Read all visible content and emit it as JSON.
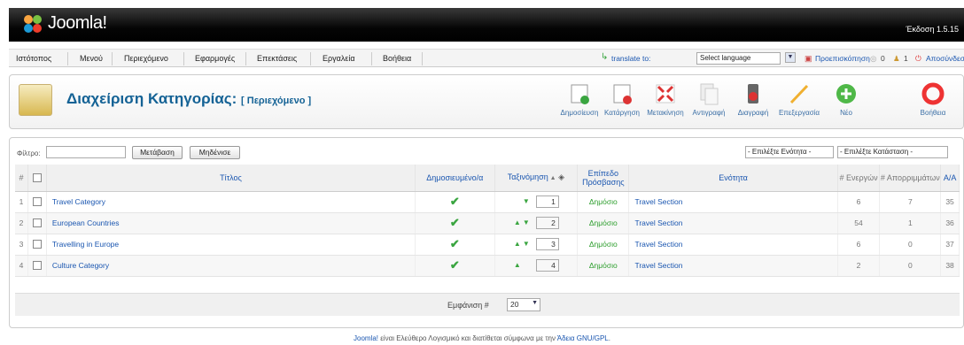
{
  "header": {
    "app_name": "Joomla!",
    "version": "Έκδοση 1.5.15"
  },
  "menu": [
    "Ιστότοπος",
    "Μενού",
    "Περιεχόμενο",
    "Εφαρμογές",
    "Επεκτάσεις",
    "Εργαλεία",
    "Βοήθεια"
  ],
  "topright": {
    "translate_label": "translate to:",
    "language_value": "Select language",
    "preview": "Προεπισκόπηση",
    "messages": "0",
    "users": "1",
    "logout": "Αποσύνδεση"
  },
  "page": {
    "title": "Διαχείριση Κατηγορίας:",
    "subtitle": "[ Περιεχόμενο ]"
  },
  "toolbar": [
    {
      "label": "Δημοσίευση",
      "icon": "publish-icon"
    },
    {
      "label": "Κατάργηση",
      "icon": "unpublish-icon"
    },
    {
      "label": "Μετακίνηση",
      "icon": "move-icon"
    },
    {
      "label": "Αντιγραφή",
      "icon": "copy-icon"
    },
    {
      "label": "Διαγραφή",
      "icon": "delete-icon"
    },
    {
      "label": "Επεξεργασία",
      "icon": "edit-icon"
    },
    {
      "label": "Νέο",
      "icon": "new-icon"
    },
    {
      "label": "Βοήθεια",
      "icon": "help-icon"
    }
  ],
  "filter": {
    "label": "Φίλτρο:",
    "value": "",
    "go": "Μετάβαση",
    "reset": "Μηδένισε",
    "section_select": "- Επιλέξτε Ενότητα -",
    "state_select": "- Επιλέξτε Κατάσταση -"
  },
  "table": {
    "headers": {
      "num": "#",
      "title": "Τίτλος",
      "published": "Δημοσιευμένο/α",
      "ordering": "Ταξινόμηση",
      "access": "Επίπεδο Πρόσβασης",
      "section": "Ενότητα",
      "active": "# Ενεργών",
      "trashed": "# Απορριμμάτων",
      "id": "A/A"
    },
    "rows": [
      {
        "num": "1",
        "title": "Travel Category",
        "order": "1",
        "access": "Δημόσιο",
        "section": "Travel Section",
        "active": "6",
        "trashed": "7",
        "id": "35"
      },
      {
        "num": "2",
        "title": "European Countries",
        "order": "2",
        "access": "Δημόσιο",
        "section": "Travel Section",
        "active": "54",
        "trashed": "1",
        "id": "36"
      },
      {
        "num": "3",
        "title": "Travelling in Europe",
        "order": "3",
        "access": "Δημόσιο",
        "section": "Travel Section",
        "active": "6",
        "trashed": "0",
        "id": "37"
      },
      {
        "num": "4",
        "title": "Culture Category",
        "order": "4",
        "access": "Δημόσιο",
        "section": "Travel Section",
        "active": "2",
        "trashed": "0",
        "id": "38"
      }
    ]
  },
  "pager": {
    "label": "Εμφάνιση #",
    "value": "20"
  },
  "footer": {
    "link1": "Joomla!",
    "text": " είναι Ελεύθερο Λογισμικό και διατίθεται σύμφωνα με την ",
    "link2": "Άδεια GNU/GPL",
    "end": "."
  }
}
